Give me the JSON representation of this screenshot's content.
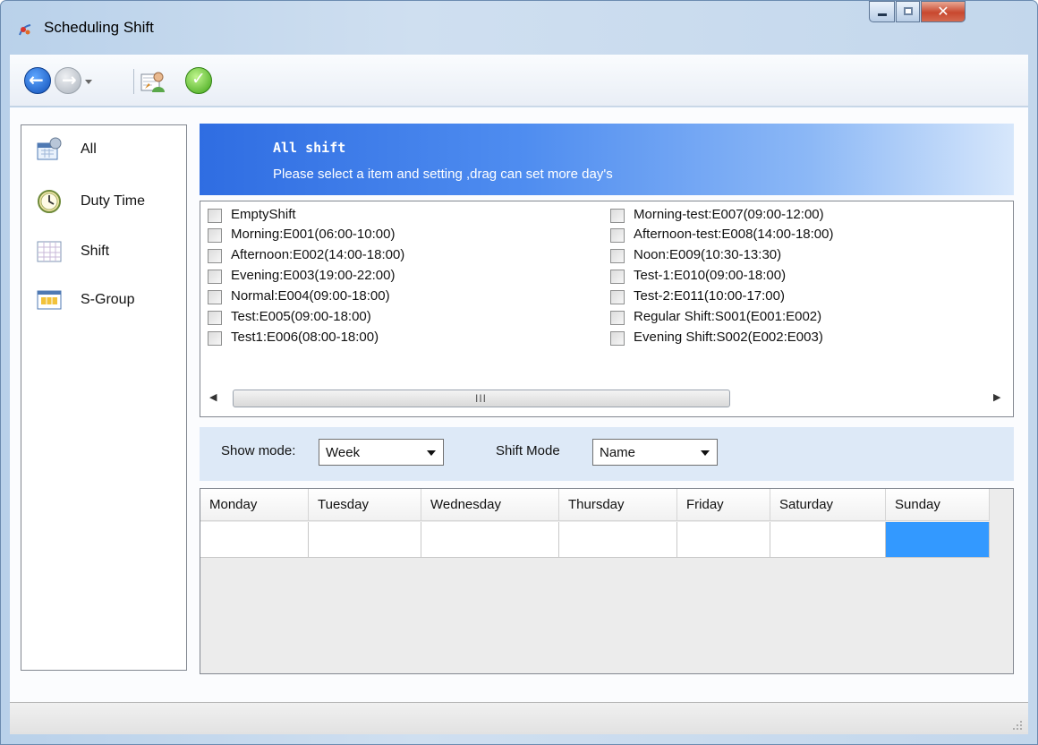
{
  "window": {
    "title": "Scheduling Shift"
  },
  "toolbar": {
    "icons": [
      "back-icon",
      "forward-icon",
      "history-dropdown-icon",
      "edit-user-icon",
      "confirm-check-icon"
    ]
  },
  "sidebar": {
    "items": [
      {
        "label": "All",
        "icon": "all-calendar-icon"
      },
      {
        "label": "Duty Time",
        "icon": "clock-icon"
      },
      {
        "label": "Shift",
        "icon": "shift-grid-icon"
      },
      {
        "label": "S-Group",
        "icon": "shift-group-icon"
      }
    ]
  },
  "banner": {
    "title": "All shift",
    "subtitle": "Please select a item and setting ,drag can set more day's"
  },
  "shifts": {
    "left": [
      {
        "label": "EmptyShift",
        "checked": false
      },
      {
        "label": "Morning:E001(06:00-10:00)",
        "checked": false
      },
      {
        "label": "Afternoon:E002(14:00-18:00)",
        "checked": false
      },
      {
        "label": "Evening:E003(19:00-22:00)",
        "checked": false
      },
      {
        "label": "Normal:E004(09:00-18:00)",
        "checked": false
      },
      {
        "label": "Test:E005(09:00-18:00)",
        "checked": false
      },
      {
        "label": "Test1:E006(08:00-18:00)",
        "checked": false
      }
    ],
    "right": [
      {
        "label": "Morning-test:E007(09:00-12:00)",
        "checked": false
      },
      {
        "label": "Afternoon-test:E008(14:00-18:00)",
        "checked": false
      },
      {
        "label": "Noon:E009(10:30-13:30)",
        "checked": false
      },
      {
        "label": "Test-1:E010(09:00-18:00)",
        "checked": false
      },
      {
        "label": "Test-2:E011(10:00-17:00)",
        "checked": false
      },
      {
        "label": "Regular Shift:S001(E001:E002)",
        "checked": false
      },
      {
        "label": "Evening Shift:S002(E002:E003)",
        "checked": false
      }
    ],
    "scroll_grip": "III"
  },
  "modes": {
    "show_mode_label": "Show mode:",
    "show_mode_value": "Week",
    "shift_mode_label": "Shift Mode",
    "shift_mode_value": "Name"
  },
  "week": {
    "days": [
      "Monday",
      "Tuesday",
      "Wednesday",
      "Thursday",
      "Friday",
      "Saturday",
      "Sunday"
    ],
    "selected_day": "Sunday"
  },
  "colors": {
    "banner_start": "#2f6de2",
    "selection": "#3399ff"
  }
}
